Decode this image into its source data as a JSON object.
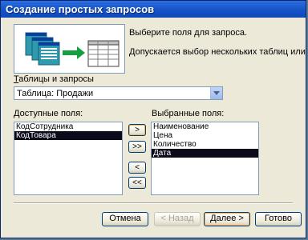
{
  "window": {
    "title": "Создание простых запросов"
  },
  "intro": {
    "line1": "Выберите поля для запроса.",
    "line2": "Допускается выбор нескольких таблиц или запросов."
  },
  "tables": {
    "label_prefix": "Т",
    "label_rest": "аблицы и запросы",
    "selected": "Таблица: Продажи"
  },
  "available": {
    "label_prefix": "Д",
    "label_rest": "оступные поля:",
    "items": [
      "КодСотрудника",
      "КодТовара"
    ],
    "selected_index": 1
  },
  "chosen": {
    "label": "Выбранные поля:",
    "items": [
      "Наименование",
      "Цена",
      "Количество",
      "Дата"
    ],
    "selected_index": 3
  },
  "move_buttons": {
    "add_one": ">",
    "add_all": ">>",
    "remove_one": "<",
    "remove_all": "<<"
  },
  "footer": {
    "cancel": "Отмена",
    "back": "< Назад",
    "next": "Далее >",
    "finish": "Готово"
  }
}
